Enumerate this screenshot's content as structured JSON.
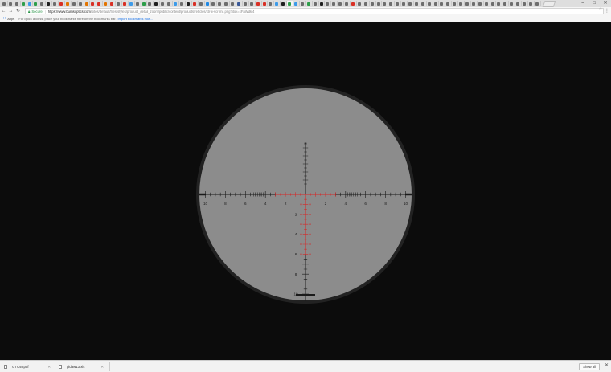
{
  "browser": {
    "tabs": {
      "favicon_colors": [
        "#6e6e6e",
        "#6e6e6e",
        "#6e6e6e",
        "#2e9e4a",
        "#3d9be9",
        "#2e9e4a",
        "#6e6e6e",
        "#202020",
        "#6e6e6e",
        "#d93025",
        "#e37400",
        "#6e6e6e",
        "#6e6e6e",
        "#e37400",
        "#d93025",
        "#d93025",
        "#e37400",
        "#d93025",
        "#6e6e6e",
        "#d93025",
        "#3d9be9",
        "#6e6e6e",
        "#2e9e4a",
        "#6e6e6e",
        "#202020",
        "#6e6e6e",
        "#6e6e6e",
        "#3d9be9",
        "#6e6e6e",
        "#202020",
        "#d93025",
        "#6e6e6e",
        "#1e88e5",
        "#6e6e6e",
        "#6e6e6e",
        "#6e6e6e",
        "#6e6e6e",
        "#3a5998",
        "#6e6e6e",
        "#6e6e6e",
        "#d93025",
        "#d93025",
        "#6e6e6e",
        "#3d9be9",
        "#202020",
        "#2e9e4a",
        "#3d9be9",
        "#6e6e6e",
        "#2e9e4a",
        "#6e6e6e",
        "#202020",
        "#6e6e6e",
        "#6e6e6e",
        "#6e6e6e",
        "#6e6e6e",
        "#d93025",
        "#6e6e6e",
        "#6e6e6e",
        "#6e6e6e",
        "#6e6e6e",
        "#6e6e6e",
        "#6e6e6e",
        "#6e6e6e",
        "#6e6e6e",
        "#6e6e6e",
        "#6e6e6e",
        "#6e6e6e",
        "#6e6e6e",
        "#6e6e6e",
        "#6e6e6e",
        "#6e6e6e",
        "#6e6e6e",
        "#6e6e6e",
        "#6e6e6e",
        "#6e6e6e",
        "#6e6e6e",
        "#6e6e6e",
        "#6e6e6e",
        "#6e6e6e",
        "#6e6e6e",
        "#6e6e6e",
        "#6e6e6e",
        "#6e6e6e",
        "#6e6e6e",
        "#6e6e6e"
      ],
      "active_index": 45
    },
    "window_controls": {
      "minimize": "–",
      "maximize": "□",
      "close": "✕"
    },
    "nav": {
      "back": "←",
      "forward": "→",
      "reload": "↻",
      "home": "⌂"
    },
    "address": {
      "security_label": "Secure",
      "url_host": "https://www.burrisoptics.com",
      "url_rest": "/sites/default/files/styles/product_detail_zoom/public/content/products/reticles/xtr-ii-scr-mil.png?itok=xFaWdkl4"
    },
    "bookmarks_bar": {
      "apps_label": "Apps",
      "hint": "For quick access, place your bookmarks here on the bookmarks bar.",
      "link": "Import bookmarks now..."
    },
    "downloads": {
      "items": [
        {
          "name": "GTCss.pdf"
        },
        {
          "name": "gldaw13.xls"
        }
      ],
      "show_all": "Show all",
      "close": "✕"
    }
  },
  "reticle": {
    "colors": {
      "background": "#0c0c0c",
      "field": "#8c8c8c",
      "ring": "#222222",
      "ticks": "#1a1a1a",
      "illuminated": "#d42a2a"
    },
    "horizontal_labels": [
      10,
      8,
      6,
      4,
      2,
      2,
      4,
      6,
      8,
      10
    ],
    "vertical_labels": [
      2,
      4,
      6,
      8,
      10
    ]
  }
}
